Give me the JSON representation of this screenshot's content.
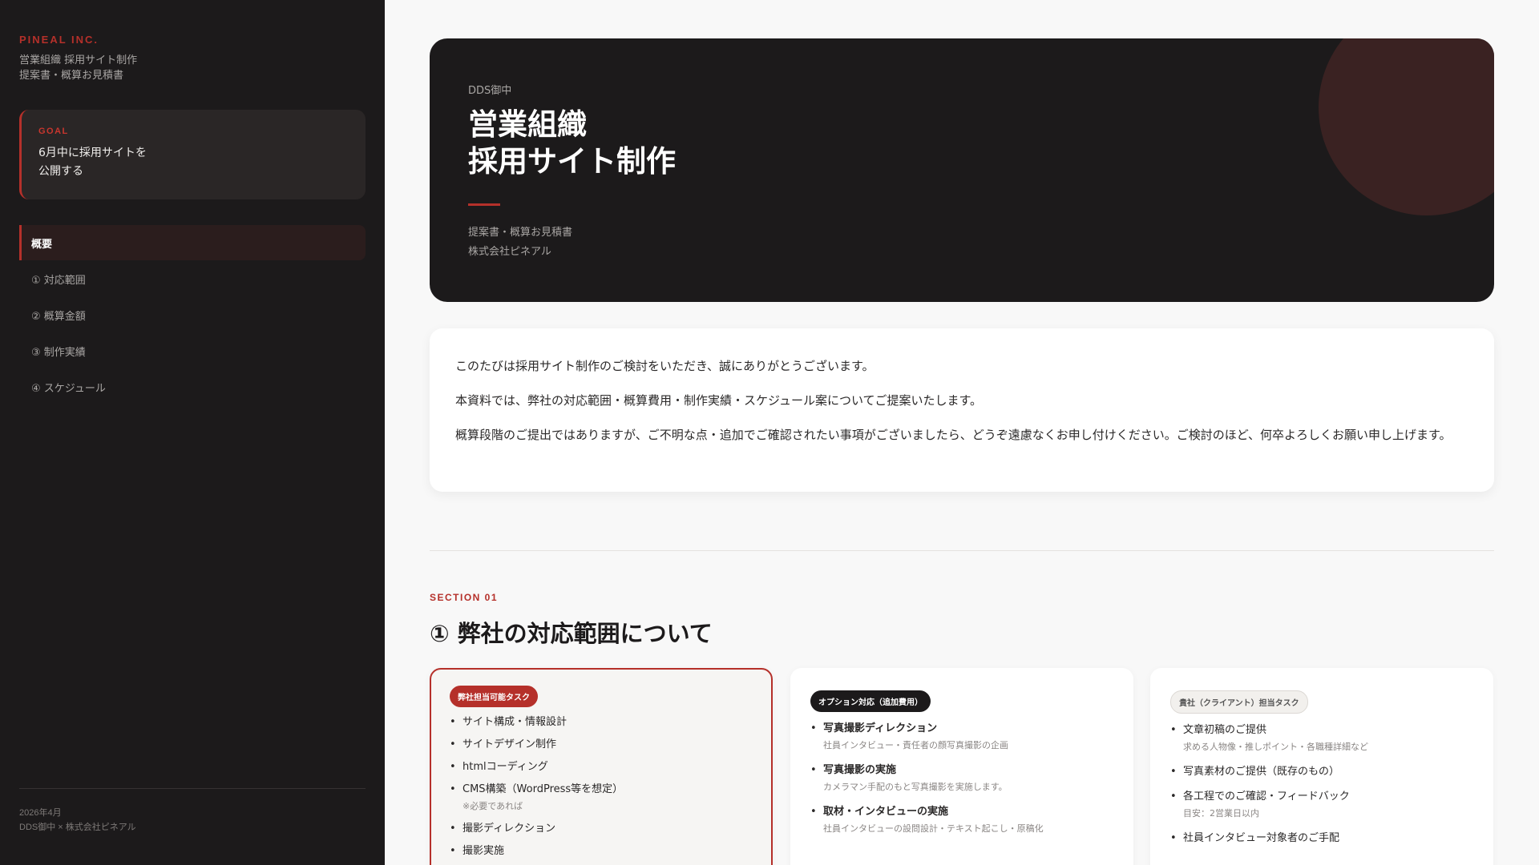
{
  "sidebar": {
    "brand": "PINEAL INC.",
    "subtitle_1": "営業組織 採用サイト制作",
    "subtitle_2": "提案書・概算お見積書",
    "goal": {
      "label": "GOAL",
      "line_1": "6月中に採用サイトを",
      "line_2": "公開する"
    },
    "nav": [
      {
        "label": "概要",
        "active": true
      },
      {
        "label": "① 対応範囲"
      },
      {
        "label": "② 概算金額"
      },
      {
        "label": "③ 制作実績"
      },
      {
        "label": "④ スケジュール"
      }
    ],
    "footer": {
      "date": "2026年4月",
      "parties": "DDS御中 × 株式会社ピネアル"
    }
  },
  "hero": {
    "to": "DDS御中",
    "title_1": "営業組織",
    "title_2": "採用サイト制作",
    "doc_type": "提案書・概算お見積書",
    "company": "株式会社ピネアル"
  },
  "intro": [
    "このたびは採用サイト制作のご検討をいただき、誠にありがとうございます。",
    "本資料では、弊社の対応範囲・概算費用・制作実績・スケジュール案についてご提案いたします。",
    "概算段階のご提出ではありますが、ご不明な点・追加でご確認されたい事項がございましたら、どうぞ遠慮なくお申し付けください。ご検討のほど、何卒よろしくお願い申し上げます。"
  ],
  "section": {
    "label": "SECTION 01",
    "title": "① 弊社の対応範囲について"
  },
  "cards": [
    {
      "badge": "弊社担当可能タスク",
      "items": [
        {
          "title": "サイト構成・情報設計"
        },
        {
          "title": "サイトデザイン制作"
        },
        {
          "title": "htmlコーディング"
        },
        {
          "title": "CMS構築（WordPress等を想定）",
          "sub": "※必要であれば"
        },
        {
          "title": "撮影ディレクション"
        },
        {
          "title": "撮影実施"
        }
      ]
    },
    {
      "badge": "オプション対応（追加費用）",
      "items": [
        {
          "title": "写真撮影ディレクション",
          "sub": "社員インタビュー・責任者の顔写真撮影の企画"
        },
        {
          "title": "写真撮影の実施",
          "sub": "カメラマン手配のもと写真撮影を実施します。"
        },
        {
          "title": "取材・インタビューの実施",
          "sub": "社員インタビューの設問設計・テキスト起こし・原稿化"
        }
      ]
    },
    {
      "badge": "貴社（クライアント）担当タスク",
      "items": [
        {
          "title": "文章初稿のご提供",
          "sub": "求める人物像・推しポイント・各職種詳細など"
        },
        {
          "title": "写真素材のご提供（既存のもの）"
        },
        {
          "title": "各工程でのご確認・フィードバック",
          "sub": "目安：2営業日以内"
        },
        {
          "title": "社員インタビュー対象者のご手配"
        }
      ]
    }
  ],
  "colors": {
    "accent": "#b5302a",
    "dark": "#1c1a1b"
  }
}
